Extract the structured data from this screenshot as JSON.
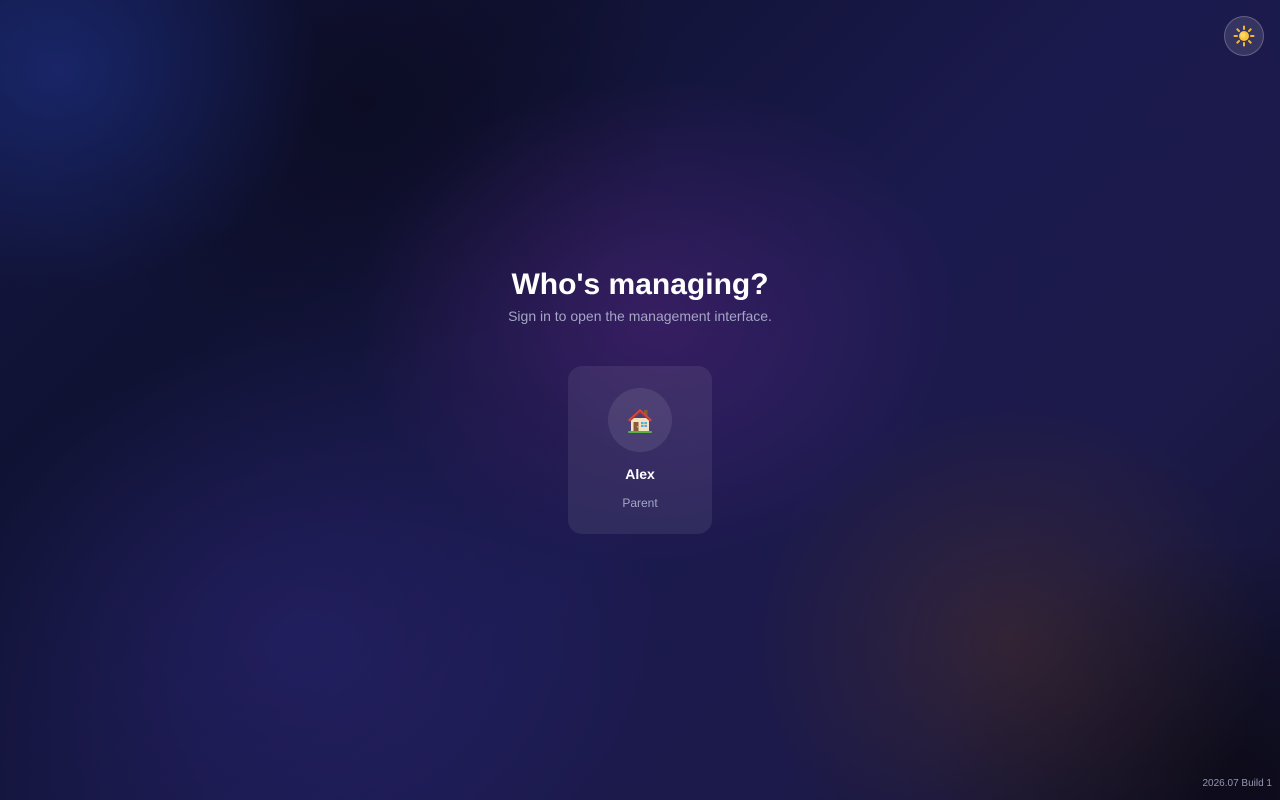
{
  "header": {
    "theme_toggle_icon": "sun-icon"
  },
  "main": {
    "title": "Who's managing?",
    "subtitle": "Sign in to open the management interface."
  },
  "profiles": [
    {
      "name": "Alex",
      "role": "Parent",
      "avatar_icon": "house-icon"
    }
  ],
  "footer": {
    "build_version": "2026.07 Build 1"
  },
  "colors": {
    "text_primary": "#ffffff",
    "text_secondary": "#a4a6c4",
    "sun_yellow": "#f5b82e",
    "house_roof": "#d9483b",
    "house_wall": "#f3e2bf"
  }
}
